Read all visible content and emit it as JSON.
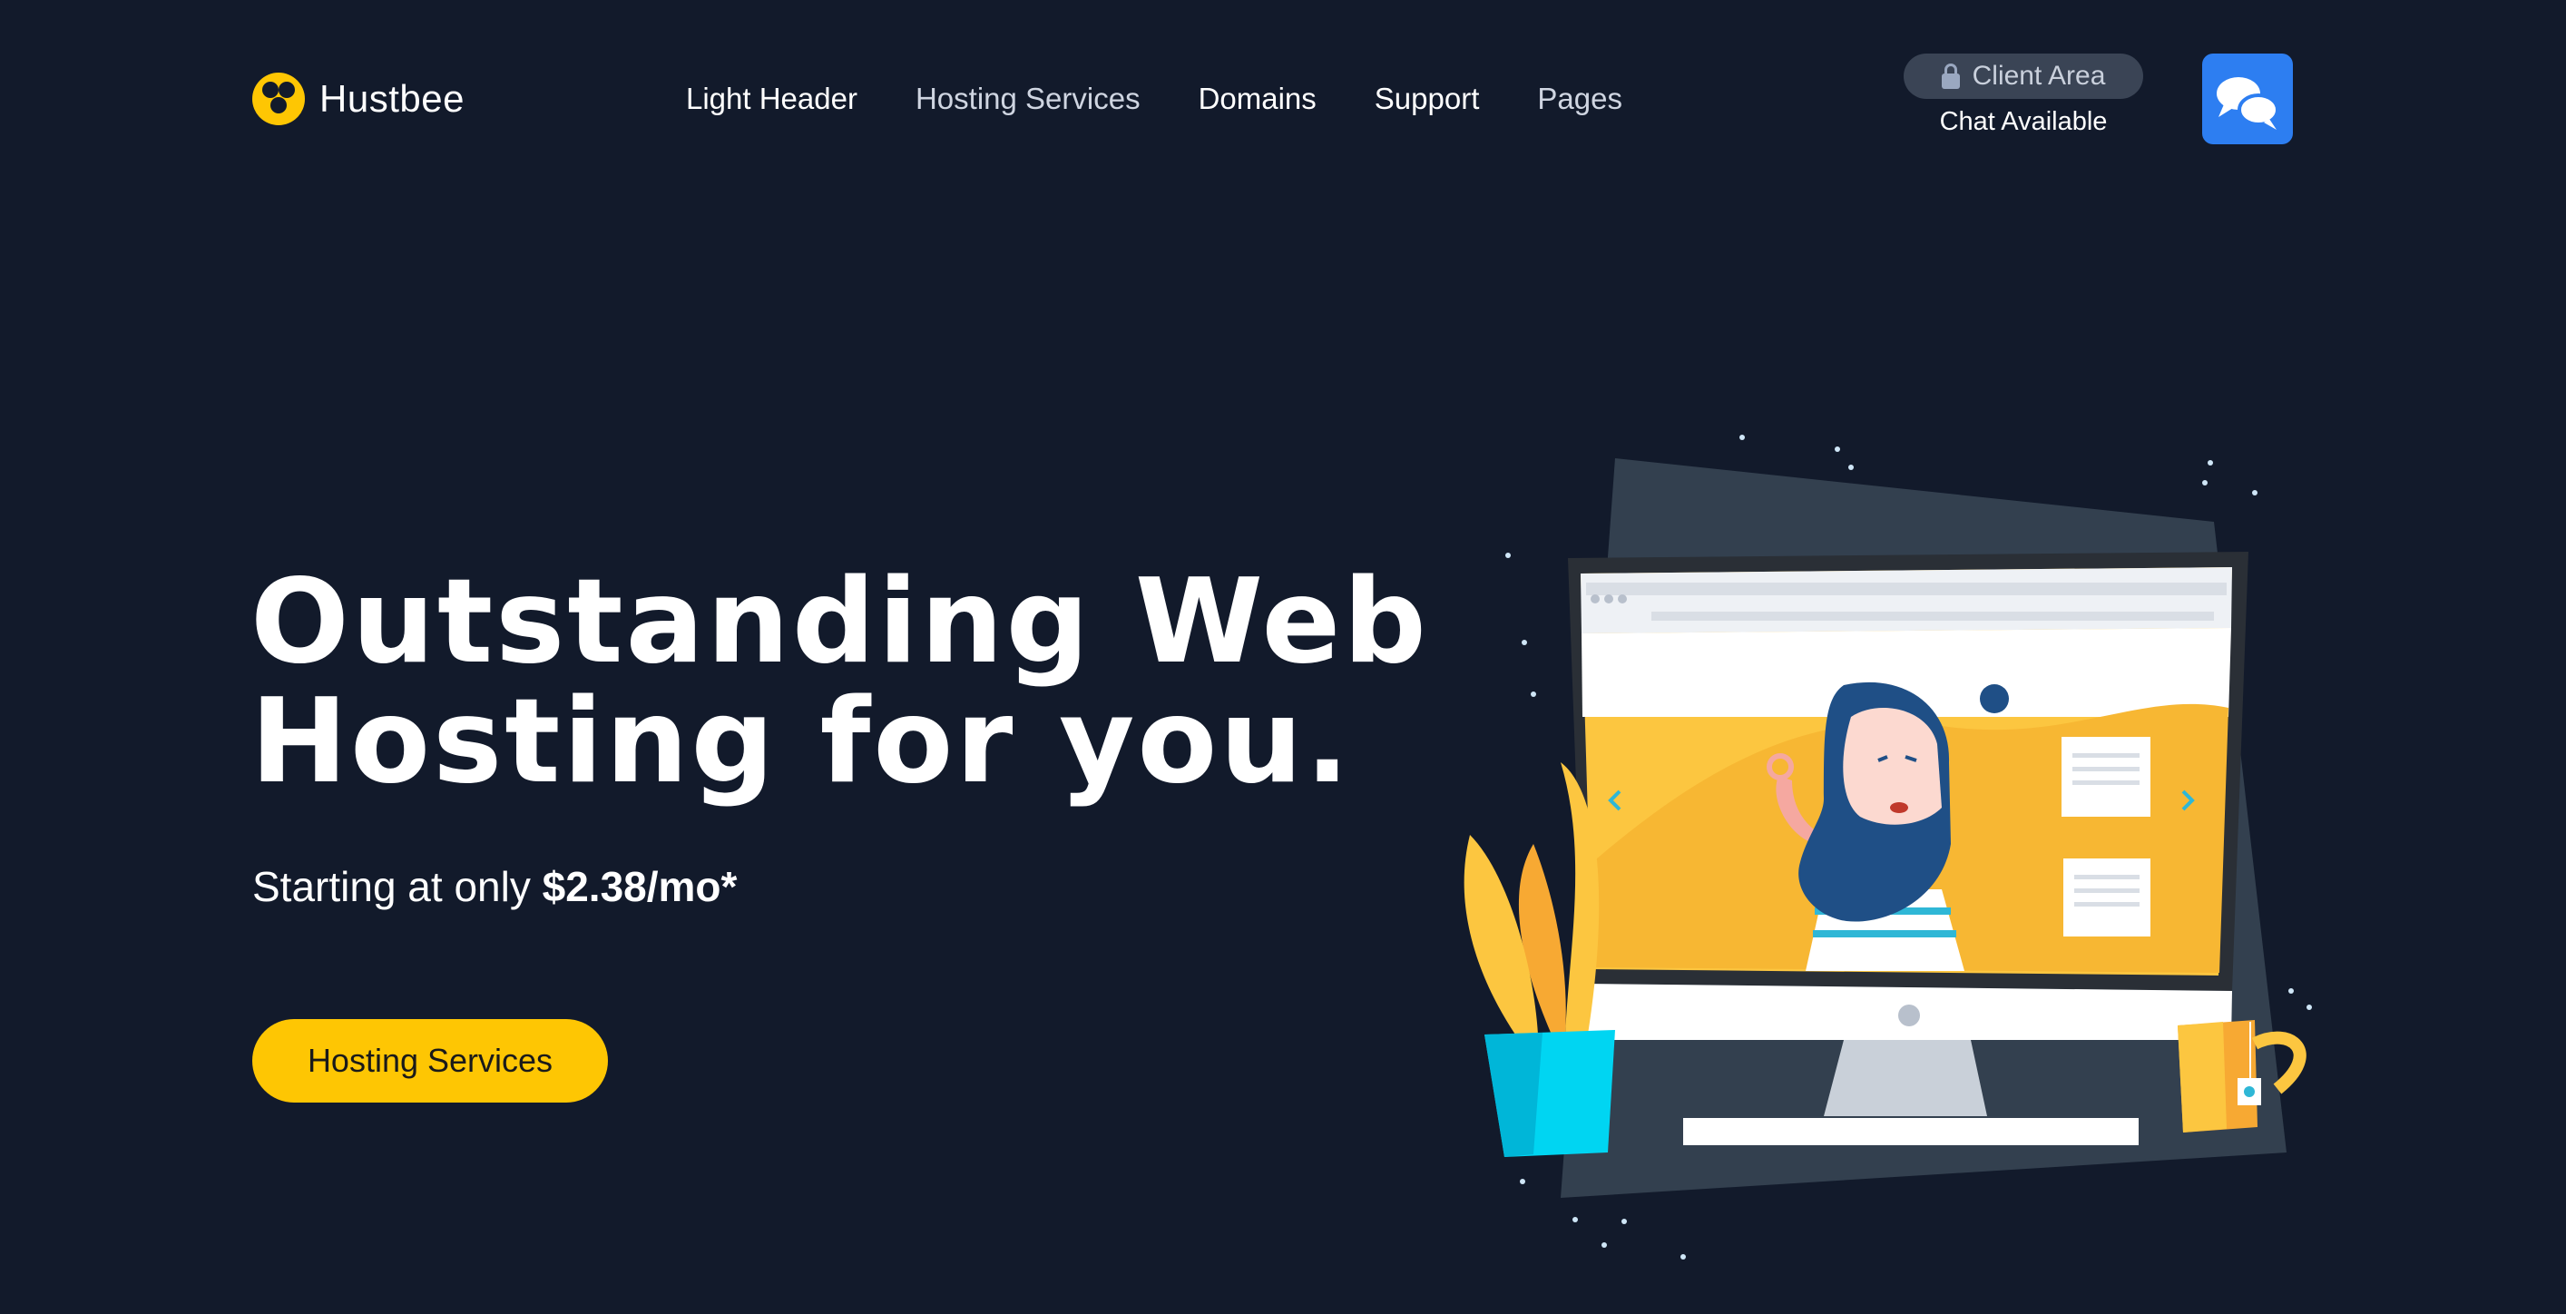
{
  "brand": {
    "name": "Hustbee",
    "logo_icon": "honeycomb-icon",
    "accent": "#fec603"
  },
  "nav": {
    "items": [
      {
        "label": "Light Header"
      },
      {
        "label": "Hosting Services"
      },
      {
        "label": "Domains"
      },
      {
        "label": "Support"
      },
      {
        "label": "Pages"
      }
    ]
  },
  "client_area": {
    "label": "Client Area",
    "icon": "lock-icon"
  },
  "chat": {
    "status": "Chat Available",
    "icon": "chat-bubbles-icon",
    "color": "#2d7ef1"
  },
  "hero": {
    "title_line1": "Outstanding Web",
    "title_line2": "Hosting for you.",
    "subtitle_prefix": "Starting at only",
    "price": "$2.38/mo*",
    "cta_label": "Hosting Services"
  },
  "colors": {
    "background": "#121a2b",
    "cta": "#fec603"
  }
}
